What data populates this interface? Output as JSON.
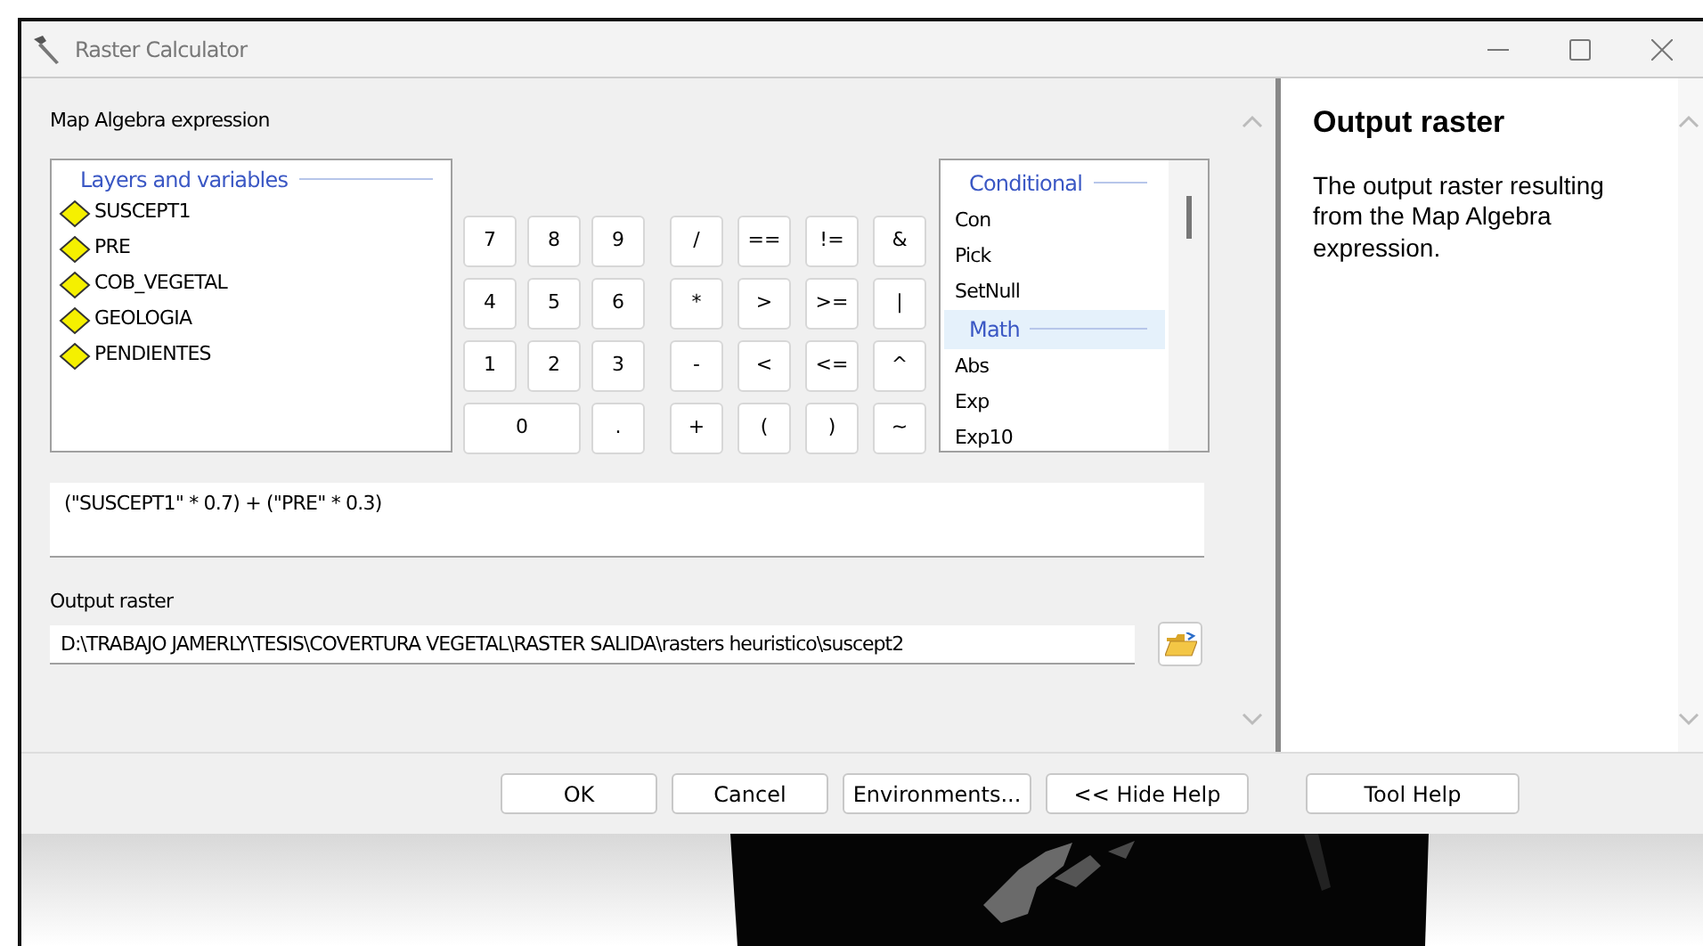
{
  "window": {
    "title": "Raster Calculator"
  },
  "expression_label": "Map Algebra expression",
  "layers": {
    "title": "Layers and variables",
    "items": [
      {
        "label": "SUSCEPT1"
      },
      {
        "label": "PRE"
      },
      {
        "label": "COB_VEGETAL"
      },
      {
        "label": "GEOLOGIA"
      },
      {
        "label": "PENDIENTES"
      }
    ]
  },
  "digit_keys": [
    {
      "label": "7",
      "kind": "normal"
    },
    {
      "label": "8",
      "kind": "normal"
    },
    {
      "label": "9",
      "kind": "normal"
    },
    {
      "label": "4",
      "kind": "normal"
    },
    {
      "label": "5",
      "kind": "normal"
    },
    {
      "label": "6",
      "kind": "normal"
    },
    {
      "label": "1",
      "kind": "normal"
    },
    {
      "label": "2",
      "kind": "normal"
    },
    {
      "label": "3",
      "kind": "normal"
    },
    {
      "label": "0",
      "kind": "wide"
    },
    {
      "label": ".",
      "kind": "normal"
    }
  ],
  "operator_keys": [
    {
      "label": "/"
    },
    {
      "label": "=="
    },
    {
      "label": "!="
    },
    {
      "label": "&"
    },
    {
      "label": "*"
    },
    {
      "label": ">"
    },
    {
      "label": ">="
    },
    {
      "label": "|"
    },
    {
      "label": "-"
    },
    {
      "label": "<"
    },
    {
      "label": "<="
    },
    {
      "label": "^"
    },
    {
      "label": "+"
    },
    {
      "label": "("
    },
    {
      "label": ")"
    },
    {
      "label": "~"
    }
  ],
  "functions": [
    {
      "label": "Conditional",
      "kind": "heading",
      "selected": false
    },
    {
      "label": "Con",
      "kind": "item",
      "selected": false
    },
    {
      "label": "Pick",
      "kind": "item",
      "selected": false
    },
    {
      "label": "SetNull",
      "kind": "item",
      "selected": false
    },
    {
      "label": "Math",
      "kind": "heading",
      "selected": true
    },
    {
      "label": "Abs",
      "kind": "item",
      "selected": false
    },
    {
      "label": "Exp",
      "kind": "item",
      "selected": false
    },
    {
      "label": "Exp10",
      "kind": "item",
      "selected": false
    }
  ],
  "expression": "(\"SUSCEPT1\" * 0.7) + (\"PRE\" * 0.3)",
  "output": {
    "label": "Output raster",
    "value": "D:\\TRABAJO JAMERLY\\TESIS\\COVERTURA VEGETAL\\RASTER SALIDA\\rasters heuristico\\suscept2"
  },
  "buttons": [
    "OK",
    "Cancel",
    "Environments...",
    "<< Hide Help",
    "Tool Help"
  ],
  "help": {
    "title": "Output raster",
    "text": "The output raster resulting from the Map Algebra expression."
  }
}
